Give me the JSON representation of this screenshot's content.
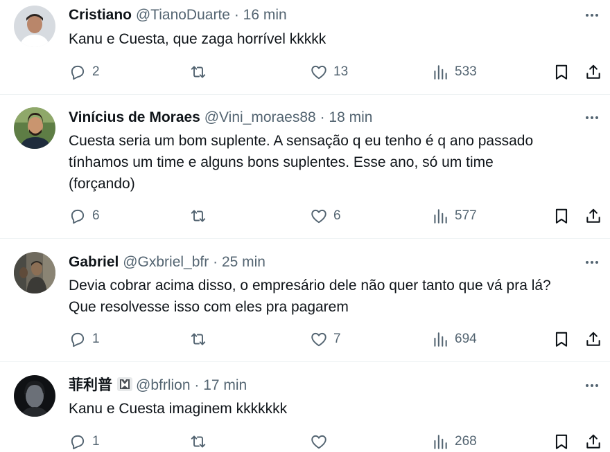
{
  "tweets": [
    {
      "name": "Cristiano",
      "handle": "@TianoDuarte",
      "separator": "·",
      "time": "16 min",
      "text_lines": [
        "Kanu e Cuesta, que zaga horrível kkkkk"
      ],
      "replies": "2",
      "retweets": "",
      "likes": "13",
      "views": "533",
      "avatar_colors": {
        "bg": "#d7dbe0",
        "skin": "#b9866a",
        "hair": "#2b2420",
        "shirt": "#ffffff"
      }
    },
    {
      "name": "Vinícius de Moraes",
      "handle": "@Vini_moraes88",
      "separator": "·",
      "time": "18 min",
      "text_lines": [
        "Cuesta seria um bom suplente. A sensação q eu tenho é q ano passado",
        "tínhamos um time e alguns bons suplentes. Esse ano, só um time",
        "(forçando)"
      ],
      "replies": "6",
      "retweets": "",
      "likes": "6",
      "views": "577",
      "avatar_colors": {
        "bg": "#5e7d45",
        "skin": "#c9956f",
        "hair": "#2a1e17",
        "shirt": "#1f2c3c"
      }
    },
    {
      "name": "Gabriel",
      "handle": "@Gxbriel_bfr",
      "separator": "·",
      "time": "25 min",
      "text_lines": [
        "Devia cobrar acima disso, o empresário dele não quer tanto que vá pra lá?",
        "Que resolvesse isso com eles pra pagarem"
      ],
      "replies": "1",
      "retweets": "",
      "likes": "7",
      "views": "694",
      "avatar_colors": {
        "bg": "#6f6a5e",
        "skin": "#8c6f55",
        "hair": "#2c2823",
        "shirt": "#3b3a36"
      }
    },
    {
      "name": "菲利普",
      "handle": "@bfrlion",
      "separator": "·",
      "time": "17 min",
      "text_lines": [
        "Kanu e Cuesta imaginem kkkkkkk"
      ],
      "replies": "1",
      "retweets": "",
      "likes": "",
      "views": "268",
      "avatar_colors": {
        "bg": "#0f1114",
        "skin": "#6b7078",
        "hair": "#1b1d20",
        "shirt": "#25282c"
      }
    }
  ],
  "colors": {
    "text": "#0f1419",
    "muted": "#536471",
    "divider": "#eff3f4"
  },
  "icons": [
    "more-icon",
    "reply-icon",
    "retweet-icon",
    "like-icon",
    "views-icon",
    "bookmark-icon",
    "share-icon",
    "verified-org-badge-icon"
  ]
}
